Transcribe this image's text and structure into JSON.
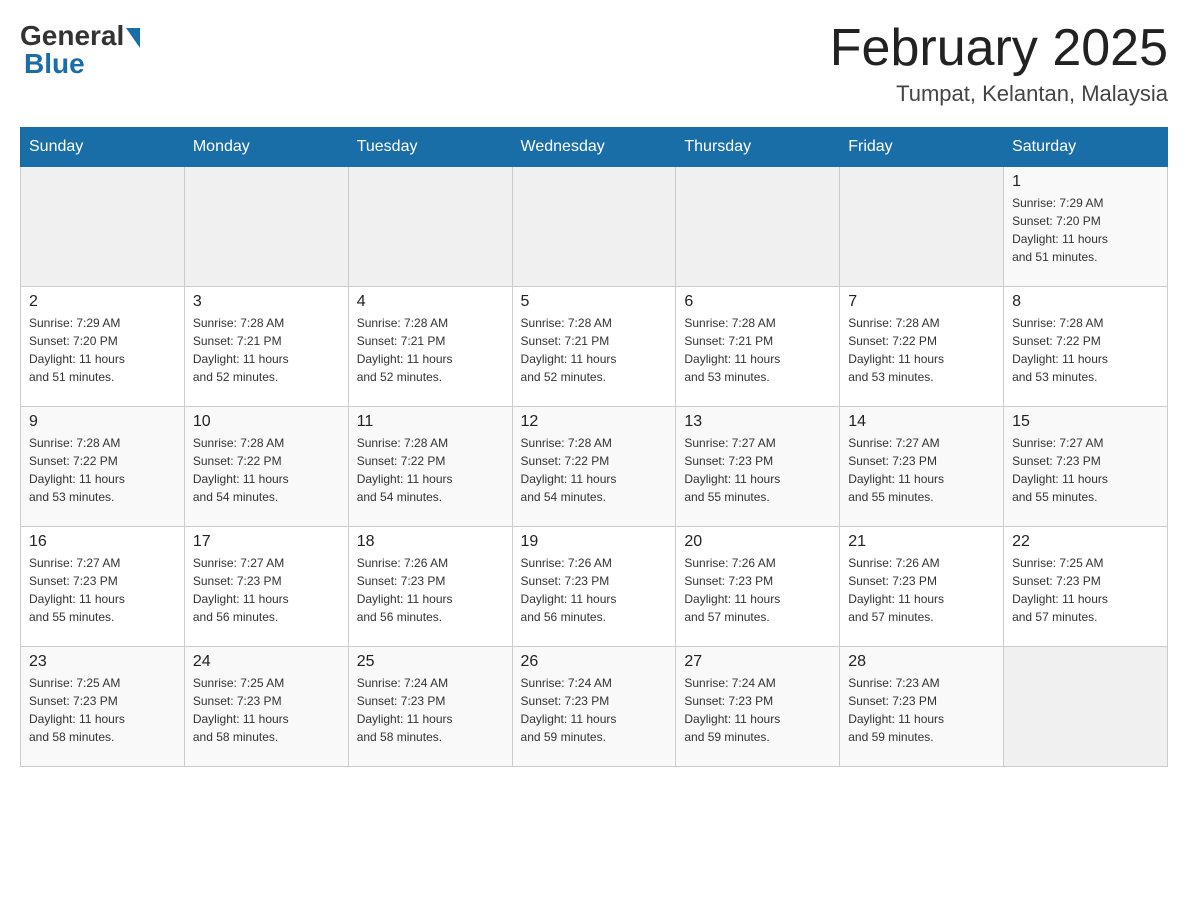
{
  "header": {
    "logo_general": "General",
    "logo_blue": "Blue",
    "title": "February 2025",
    "location": "Tumpat, Kelantan, Malaysia"
  },
  "weekdays": [
    "Sunday",
    "Monday",
    "Tuesday",
    "Wednesday",
    "Thursday",
    "Friday",
    "Saturday"
  ],
  "weeks": [
    [
      {
        "day": "",
        "info": ""
      },
      {
        "day": "",
        "info": ""
      },
      {
        "day": "",
        "info": ""
      },
      {
        "day": "",
        "info": ""
      },
      {
        "day": "",
        "info": ""
      },
      {
        "day": "",
        "info": ""
      },
      {
        "day": "1",
        "info": "Sunrise: 7:29 AM\nSunset: 7:20 PM\nDaylight: 11 hours\nand 51 minutes."
      }
    ],
    [
      {
        "day": "2",
        "info": "Sunrise: 7:29 AM\nSunset: 7:20 PM\nDaylight: 11 hours\nand 51 minutes."
      },
      {
        "day": "3",
        "info": "Sunrise: 7:28 AM\nSunset: 7:21 PM\nDaylight: 11 hours\nand 52 minutes."
      },
      {
        "day": "4",
        "info": "Sunrise: 7:28 AM\nSunset: 7:21 PM\nDaylight: 11 hours\nand 52 minutes."
      },
      {
        "day": "5",
        "info": "Sunrise: 7:28 AM\nSunset: 7:21 PM\nDaylight: 11 hours\nand 52 minutes."
      },
      {
        "day": "6",
        "info": "Sunrise: 7:28 AM\nSunset: 7:21 PM\nDaylight: 11 hours\nand 53 minutes."
      },
      {
        "day": "7",
        "info": "Sunrise: 7:28 AM\nSunset: 7:22 PM\nDaylight: 11 hours\nand 53 minutes."
      },
      {
        "day": "8",
        "info": "Sunrise: 7:28 AM\nSunset: 7:22 PM\nDaylight: 11 hours\nand 53 minutes."
      }
    ],
    [
      {
        "day": "9",
        "info": "Sunrise: 7:28 AM\nSunset: 7:22 PM\nDaylight: 11 hours\nand 53 minutes."
      },
      {
        "day": "10",
        "info": "Sunrise: 7:28 AM\nSunset: 7:22 PM\nDaylight: 11 hours\nand 54 minutes."
      },
      {
        "day": "11",
        "info": "Sunrise: 7:28 AM\nSunset: 7:22 PM\nDaylight: 11 hours\nand 54 minutes."
      },
      {
        "day": "12",
        "info": "Sunrise: 7:28 AM\nSunset: 7:22 PM\nDaylight: 11 hours\nand 54 minutes."
      },
      {
        "day": "13",
        "info": "Sunrise: 7:27 AM\nSunset: 7:23 PM\nDaylight: 11 hours\nand 55 minutes."
      },
      {
        "day": "14",
        "info": "Sunrise: 7:27 AM\nSunset: 7:23 PM\nDaylight: 11 hours\nand 55 minutes."
      },
      {
        "day": "15",
        "info": "Sunrise: 7:27 AM\nSunset: 7:23 PM\nDaylight: 11 hours\nand 55 minutes."
      }
    ],
    [
      {
        "day": "16",
        "info": "Sunrise: 7:27 AM\nSunset: 7:23 PM\nDaylight: 11 hours\nand 55 minutes."
      },
      {
        "day": "17",
        "info": "Sunrise: 7:27 AM\nSunset: 7:23 PM\nDaylight: 11 hours\nand 56 minutes."
      },
      {
        "day": "18",
        "info": "Sunrise: 7:26 AM\nSunset: 7:23 PM\nDaylight: 11 hours\nand 56 minutes."
      },
      {
        "day": "19",
        "info": "Sunrise: 7:26 AM\nSunset: 7:23 PM\nDaylight: 11 hours\nand 56 minutes."
      },
      {
        "day": "20",
        "info": "Sunrise: 7:26 AM\nSunset: 7:23 PM\nDaylight: 11 hours\nand 57 minutes."
      },
      {
        "day": "21",
        "info": "Sunrise: 7:26 AM\nSunset: 7:23 PM\nDaylight: 11 hours\nand 57 minutes."
      },
      {
        "day": "22",
        "info": "Sunrise: 7:25 AM\nSunset: 7:23 PM\nDaylight: 11 hours\nand 57 minutes."
      }
    ],
    [
      {
        "day": "23",
        "info": "Sunrise: 7:25 AM\nSunset: 7:23 PM\nDaylight: 11 hours\nand 58 minutes."
      },
      {
        "day": "24",
        "info": "Sunrise: 7:25 AM\nSunset: 7:23 PM\nDaylight: 11 hours\nand 58 minutes."
      },
      {
        "day": "25",
        "info": "Sunrise: 7:24 AM\nSunset: 7:23 PM\nDaylight: 11 hours\nand 58 minutes."
      },
      {
        "day": "26",
        "info": "Sunrise: 7:24 AM\nSunset: 7:23 PM\nDaylight: 11 hours\nand 59 minutes."
      },
      {
        "day": "27",
        "info": "Sunrise: 7:24 AM\nSunset: 7:23 PM\nDaylight: 11 hours\nand 59 minutes."
      },
      {
        "day": "28",
        "info": "Sunrise: 7:23 AM\nSunset: 7:23 PM\nDaylight: 11 hours\nand 59 minutes."
      },
      {
        "day": "",
        "info": ""
      }
    ]
  ]
}
